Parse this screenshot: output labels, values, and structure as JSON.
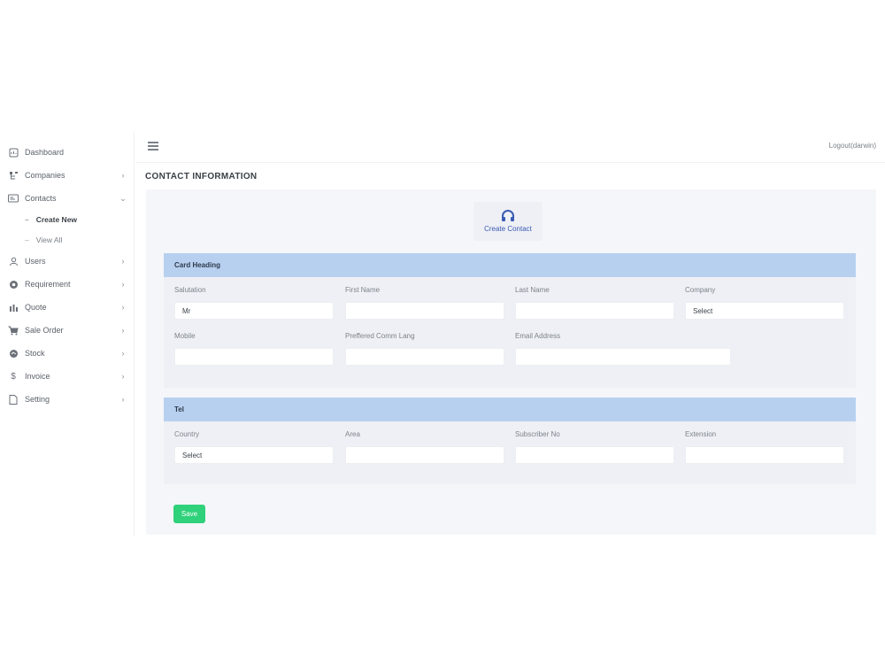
{
  "sidebar": {
    "items": [
      {
        "label": "Dashboard",
        "icon": "dashboard-icon",
        "chevron": false
      },
      {
        "label": "Companies",
        "icon": "hierarchy-icon",
        "chevron": true
      },
      {
        "label": "Contacts",
        "icon": "contact-card-icon",
        "chevron": true
      },
      {
        "label": "Users",
        "icon": "user-icon",
        "chevron": true
      },
      {
        "label": "Requirement",
        "icon": "gear-icon",
        "chevron": true
      },
      {
        "label": "Quote",
        "icon": "bar-chart-icon",
        "chevron": true
      },
      {
        "label": "Sale Order",
        "icon": "cart-icon",
        "chevron": true
      },
      {
        "label": "Stock",
        "icon": "stock-icon",
        "chevron": true
      },
      {
        "label": "Invoice",
        "icon": "dollar-icon",
        "chevron": true
      },
      {
        "label": "Setting",
        "icon": "document-icon",
        "chevron": true
      }
    ],
    "contacts_sub": [
      {
        "label": "Create New",
        "active": true
      },
      {
        "label": "View All",
        "active": false
      }
    ]
  },
  "topbar": {
    "logout": "Logout(darwin)"
  },
  "page": {
    "title": "CONTACT INFORMATION"
  },
  "create_card": {
    "title": "Create Contact",
    "icon": "headphones-icon",
    "accent": "#3b5bb4"
  },
  "section_heading": {
    "title": "Card Heading",
    "fields": [
      {
        "label": "Salutation",
        "value": "Mr"
      },
      {
        "label": "First Name",
        "value": ""
      },
      {
        "label": "Last Name",
        "value": ""
      },
      {
        "label": "Company",
        "value": "Select"
      },
      {
        "label": "Mobile",
        "value": ""
      },
      {
        "label": "Preffered Comm Lang",
        "value": ""
      },
      {
        "label": "Email Address",
        "value": ""
      }
    ]
  },
  "section_tel": {
    "title": "Tel",
    "fields": [
      {
        "label": "Country",
        "value": "Select"
      },
      {
        "label": "Area",
        "value": ""
      },
      {
        "label": "Subscriber No",
        "value": ""
      },
      {
        "label": "Extension",
        "value": ""
      }
    ]
  },
  "actions": {
    "save": "Save",
    "save_color": "#2fd17a"
  },
  "colors": {
    "section_header": "#b7d0ef",
    "panel_bg": "#f5f6f9"
  }
}
